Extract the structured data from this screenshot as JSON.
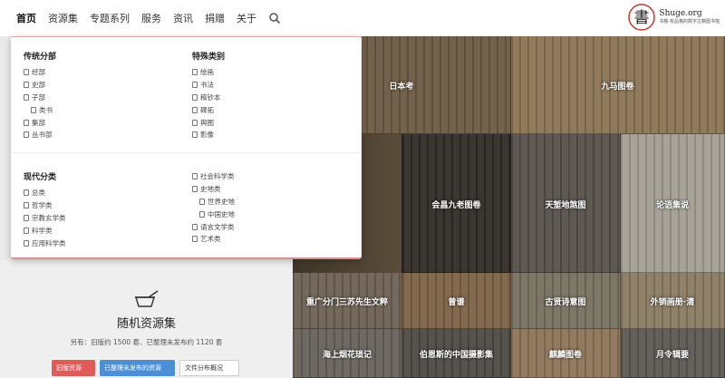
{
  "nav": {
    "items": [
      {
        "label": "首页",
        "name": "nav-home",
        "active": true
      },
      {
        "label": "资源集",
        "name": "nav-collections",
        "active": false
      },
      {
        "label": "专题系列",
        "name": "nav-series",
        "active": false
      },
      {
        "label": "服务",
        "name": "nav-services",
        "active": false
      },
      {
        "label": "资讯",
        "name": "nav-news",
        "active": false
      },
      {
        "label": "捐赠",
        "name": "nav-donate",
        "active": false
      },
      {
        "label": "关于",
        "name": "nav-about",
        "active": false
      }
    ],
    "search_icon": "search-icon"
  },
  "logo": {
    "seal_char": "書",
    "title": "Shuge.org",
    "subtitle": "书格·有品格的数字古籍图书馆"
  },
  "menu": {
    "traditional": {
      "heading": "传统分部",
      "items": [
        {
          "label": "经部",
          "sub": false
        },
        {
          "label": "史部",
          "sub": false
        },
        {
          "label": "子部",
          "sub": false
        },
        {
          "label": "类书",
          "sub": true
        },
        {
          "label": "集部",
          "sub": false
        },
        {
          "label": "丛书部",
          "sub": false
        }
      ]
    },
    "special": {
      "heading": "特殊类别",
      "items": [
        {
          "label": "绘画",
          "sub": false
        },
        {
          "label": "书法",
          "sub": false
        },
        {
          "label": "稿钞本",
          "sub": false
        },
        {
          "label": "碑拓",
          "sub": false
        },
        {
          "label": "舆图",
          "sub": false
        },
        {
          "label": "影像",
          "sub": false
        }
      ]
    },
    "modern": {
      "heading": "现代分类",
      "items": [
        {
          "label": "总类",
          "sub": false
        },
        {
          "label": "哲学类",
          "sub": false
        },
        {
          "label": "宗教玄学类",
          "sub": false
        },
        {
          "label": "科学类",
          "sub": false
        },
        {
          "label": "应用科学类",
          "sub": false
        }
      ]
    },
    "modern2": {
      "items": [
        {
          "label": "社会科学类",
          "sub": false
        },
        {
          "label": "史地类",
          "sub": false
        },
        {
          "label": "世界史地",
          "sub": true
        },
        {
          "label": "中国史地",
          "sub": true
        },
        {
          "label": "语言文学类",
          "sub": false
        },
        {
          "label": "艺术类",
          "sub": false
        }
      ]
    }
  },
  "random": {
    "title": "随机资源集",
    "stats": "另有：旧版约 1500 套、已整理未发布约 1120 套",
    "buttons": [
      {
        "label": "旧版资源",
        "style": "red"
      },
      {
        "label": "已整理未发布的资源",
        "style": "blue"
      },
      {
        "label": "文件分布概况",
        "style": "white"
      }
    ]
  },
  "tiles": [
    {
      "label": "日本考",
      "color": "#6b5a43"
    },
    {
      "label": "九马图卷",
      "color": "#8a7453"
    },
    {
      "label": "会昌九老图卷",
      "color": "#2f2b27"
    },
    {
      "label": "天堑地煞图",
      "color": "#555049"
    },
    {
      "label": "论语集说",
      "color": "#a39e93"
    },
    {
      "label": "重广分门三苏先生文粹",
      "color": "#6d6153"
    },
    {
      "label": "曾谱",
      "color": "#7c6245"
    },
    {
      "label": "古贤诗意图",
      "color": "#76705f"
    },
    {
      "label": "外销画册·清",
      "color": "#8a7a62"
    },
    {
      "label": "海上烟花琐记",
      "color": "#66615a"
    },
    {
      "label": "伯恩斯的中国摄影集",
      "color": "#4d4a46"
    },
    {
      "label": "麒麟图卷",
      "color": "#8c7458"
    },
    {
      "label": "月令辑要",
      "color": "#5c5852"
    }
  ]
}
